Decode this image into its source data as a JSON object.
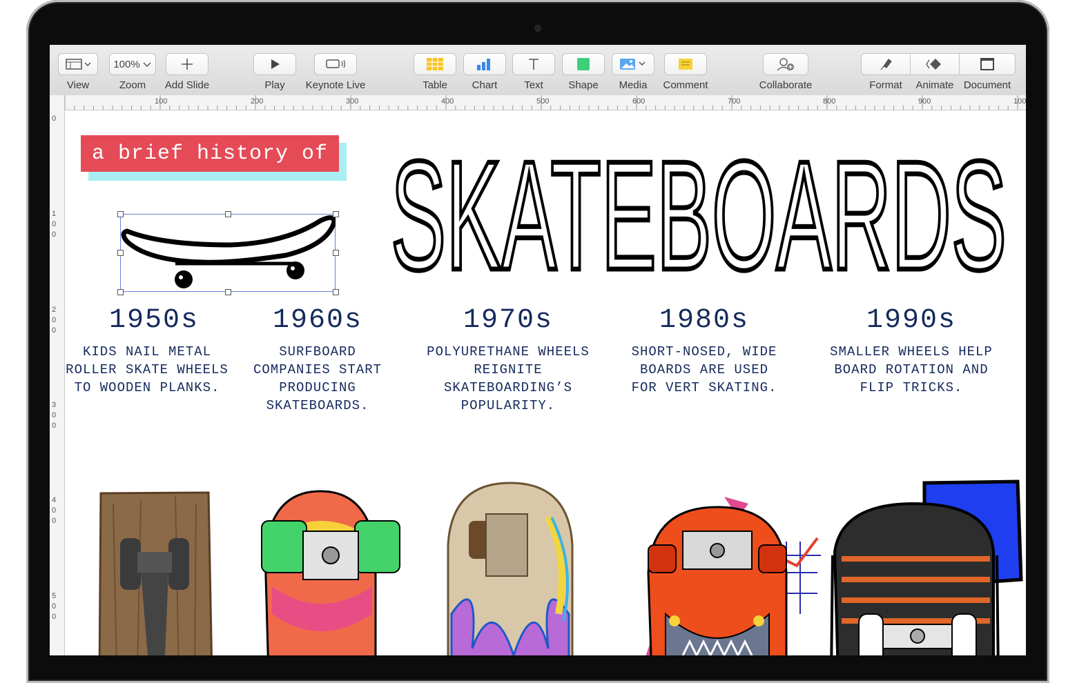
{
  "toolbar": {
    "view_label": "View",
    "zoom_value": "100%",
    "zoom_label": "Zoom",
    "add_slide_label": "Add Slide",
    "play_label": "Play",
    "keynote_live_label": "Keynote Live",
    "table_label": "Table",
    "chart_label": "Chart",
    "text_label": "Text",
    "shape_label": "Shape",
    "media_label": "Media",
    "comment_label": "Comment",
    "collaborate_label": "Collaborate",
    "format_label": "Format",
    "animate_label": "Animate",
    "document_label": "Document"
  },
  "ruler": {
    "top_ticks": [
      "100",
      "200",
      "300",
      "400",
      "500",
      "600",
      "700",
      "800",
      "900",
      "100"
    ],
    "left_ticks": [
      "0",
      "1\n0\n0",
      "2\n0\n0",
      "3\n0\n0",
      "4\n0\n0",
      "5\n0\n0"
    ]
  },
  "slide": {
    "subtitle": "a brief history of",
    "title": "SKATEBOARDS",
    "timeline": [
      {
        "decade": "1950s",
        "text": "KIDS NAIL METAL ROLLER SKATE WHEELS TO WOODEN PLANKS."
      },
      {
        "decade": "1960s",
        "text": "SURFBOARD COMPANIES START PRODUCING SKATEBOARDS."
      },
      {
        "decade": "1970s",
        "text": "POLYURETHANE WHEELS REIGNITE SKATEBOARDING’S POPULARITY."
      },
      {
        "decade": "1980s",
        "text": "SHORT-NOSED, WIDE BOARDS ARE USED FOR VERT SKATING."
      },
      {
        "decade": "1990s",
        "text": "SMALLER WHEELS HELP BOARD ROTATION AND FLIP TRICKS."
      }
    ]
  },
  "colors": {
    "subtitle_bg": "#e44b57",
    "subtitle_shadow": "#a8eef2",
    "text_navy": "#152a5c"
  }
}
